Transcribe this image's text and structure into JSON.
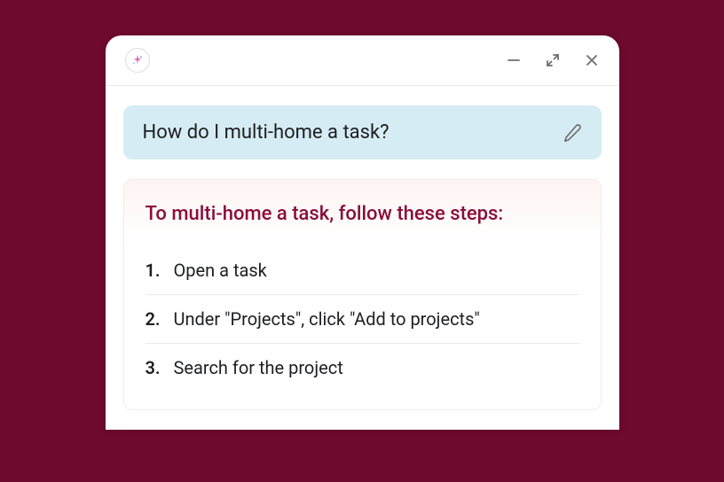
{
  "question": "How do I multi-home a task?",
  "answer": {
    "title": "To multi-home a task, follow these steps:",
    "steps": [
      "Open a task",
      "Under \"Projects\", click \"Add to projects\"",
      "Search for the project"
    ]
  }
}
